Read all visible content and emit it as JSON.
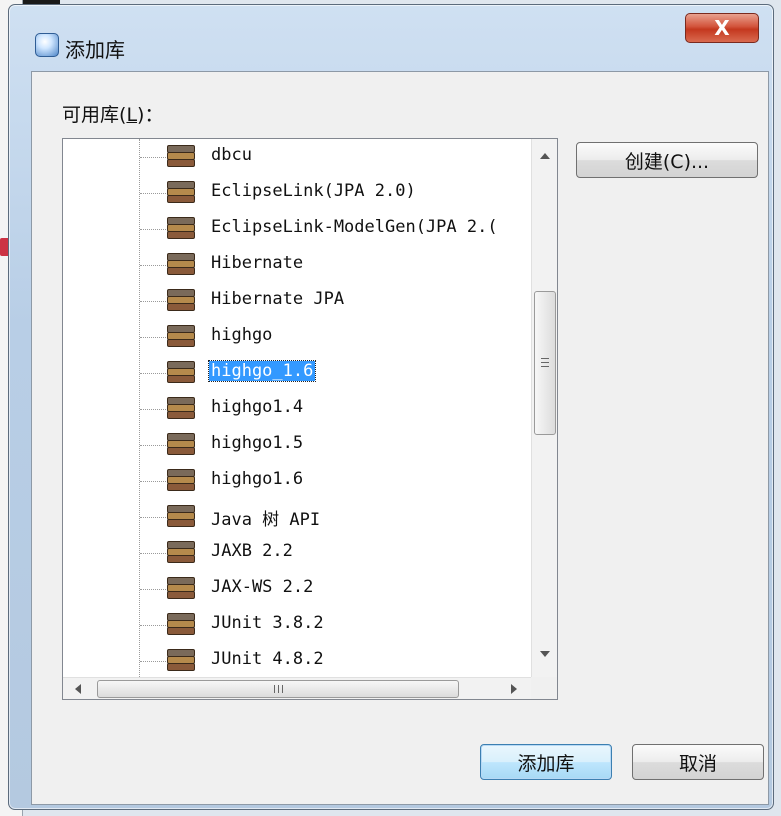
{
  "window": {
    "title": "添加库",
    "close_label": "X"
  },
  "libraries": {
    "label": "可用库",
    "mnemonic": "L",
    "label_suffix": "：",
    "items": [
      "dbcu",
      "EclipseLink(JPA 2.0)",
      "EclipseLink-ModelGen(JPA 2.(",
      "Hibernate",
      "Hibernate JPA",
      "highgo",
      "highgo_1.6",
      "highgo1.4",
      "highgo1.5",
      "highgo1.6",
      "Java 树 API",
      "JAXB 2.2",
      "JAX-WS 2.2",
      "JUnit 3.8.2",
      "JUnit 4.8.2"
    ],
    "selected": "highgo_1.6"
  },
  "buttons": {
    "create": "创建(C)...",
    "add": "添加库",
    "cancel": "取消"
  },
  "scrollbar": {
    "h_grip": "III",
    "v_grip": "≡"
  }
}
